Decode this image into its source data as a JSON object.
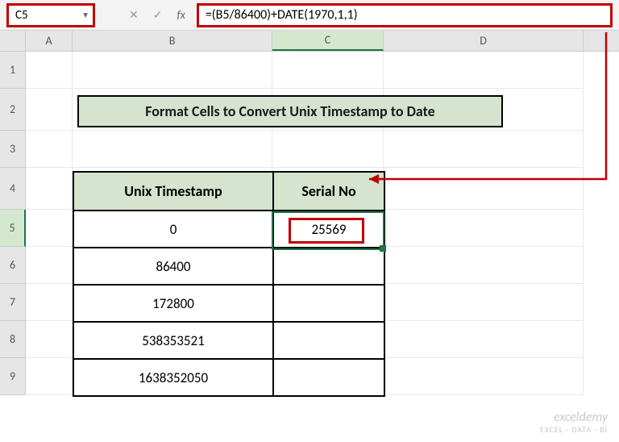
{
  "nameBox": {
    "value": "C5"
  },
  "formulaBar": {
    "fx": "fx",
    "formula": "=(B5/86400)+DATE(1970,1,1)"
  },
  "columns": {
    "A": "A",
    "B": "B",
    "C": "C",
    "D": "D"
  },
  "rows": {
    "r1": "1",
    "r2": "2",
    "r3": "3",
    "r4": "4",
    "r5": "5",
    "r6": "6",
    "r7": "7",
    "r8": "8",
    "r9": "9"
  },
  "title": "Format Cells to Convert Unix Timestamp to Date",
  "table": {
    "headers": {
      "unix": "Unix Timestamp",
      "serial": "Serial No"
    },
    "rows": [
      {
        "unix": "0",
        "serial": "25569"
      },
      {
        "unix": "86400",
        "serial": ""
      },
      {
        "unix": "172800",
        "serial": ""
      },
      {
        "unix": "538353521",
        "serial": ""
      },
      {
        "unix": "1638352050",
        "serial": ""
      }
    ]
  },
  "watermark": {
    "brand": "exceldemy",
    "tagline": "EXCEL · DATA · BI"
  }
}
